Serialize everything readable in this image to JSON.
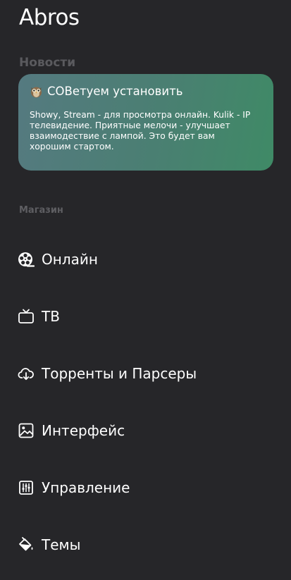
{
  "app": {
    "title": "Abros"
  },
  "news": {
    "section_label": "Новости",
    "card": {
      "title": "СОВетуем установить",
      "icon": "owl-icon",
      "body": "Showy, Stream - для просмотра онлайн. Kulik - IP телевидение. Приятные мелочи - улучшает взаимодествие с лампой. Это будет вам хорошим стартом.",
      "gradient_start": "#557a80",
      "gradient_end": "#3f8a66"
    }
  },
  "shop": {
    "section_label": "Магазин",
    "items": [
      {
        "label": "Онлайн",
        "icon": "film-reel-icon"
      },
      {
        "label": "ТВ",
        "icon": "tv-icon"
      },
      {
        "label": "Торренты и Парсеры",
        "icon": "cloud-download-icon"
      },
      {
        "label": "Интерфейс",
        "icon": "image-icon"
      },
      {
        "label": "Управление",
        "icon": "sliders-icon"
      },
      {
        "label": "Темы",
        "icon": "paint-bucket-icon"
      }
    ]
  },
  "colors": {
    "background": "#262629",
    "section_label": "#5a5a5e",
    "text": "#ffffff"
  }
}
